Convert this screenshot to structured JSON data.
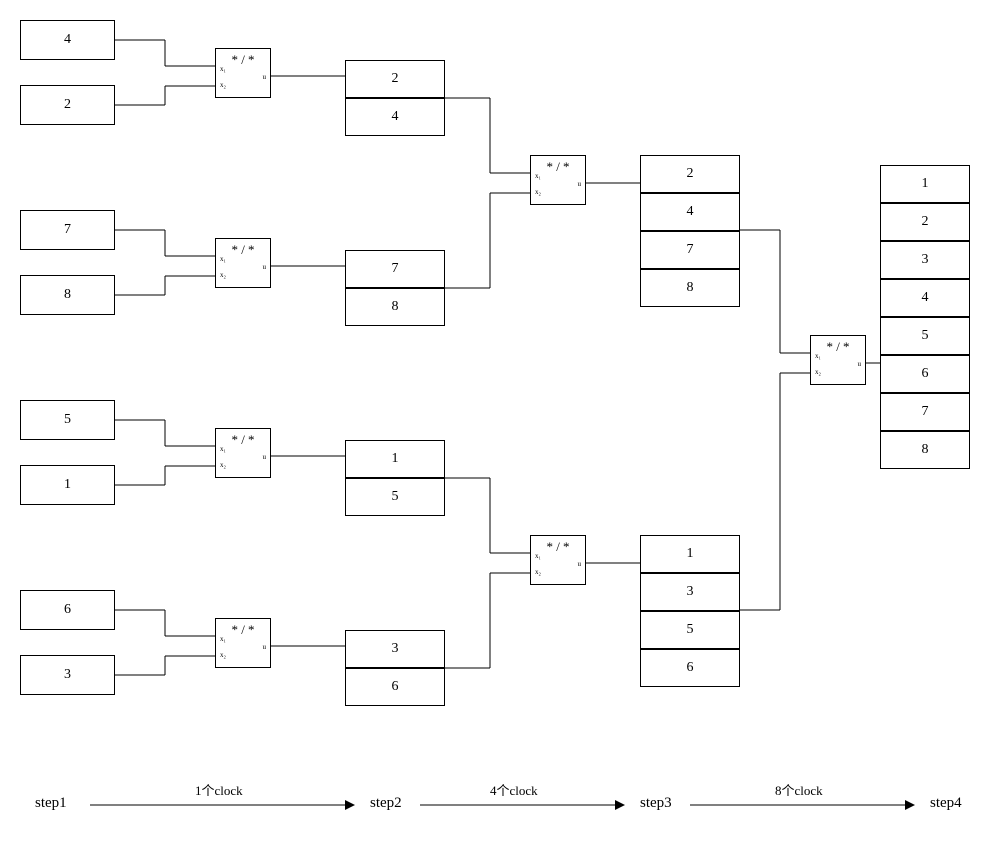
{
  "inputs": {
    "pair1": {
      "a": "4",
      "b": "2"
    },
    "pair2": {
      "a": "7",
      "b": "8"
    },
    "pair3": {
      "a": "5",
      "b": "1"
    },
    "pair4": {
      "a": "6",
      "b": "3"
    }
  },
  "stage2": {
    "stackA": [
      "2",
      "4"
    ],
    "stackB": [
      "7",
      "8"
    ],
    "stackC": [
      "1",
      "5"
    ],
    "stackD": [
      "3",
      "6"
    ]
  },
  "stage3": {
    "stackTop": [
      "2",
      "4",
      "7",
      "8"
    ],
    "stackBot": [
      "1",
      "3",
      "5",
      "6"
    ]
  },
  "stage4": {
    "final": [
      "1",
      "2",
      "3",
      "4",
      "5",
      "6",
      "7",
      "8"
    ]
  },
  "comparator": {
    "op": "* / *",
    "in1": "x₁",
    "in2": "x₂",
    "out": "u"
  },
  "steps": {
    "s1": "step1",
    "s2": "step2",
    "s3": "step3",
    "s4": "step4",
    "c1": "1个clock",
    "c4": "4个clock",
    "c8": "8个clock"
  }
}
